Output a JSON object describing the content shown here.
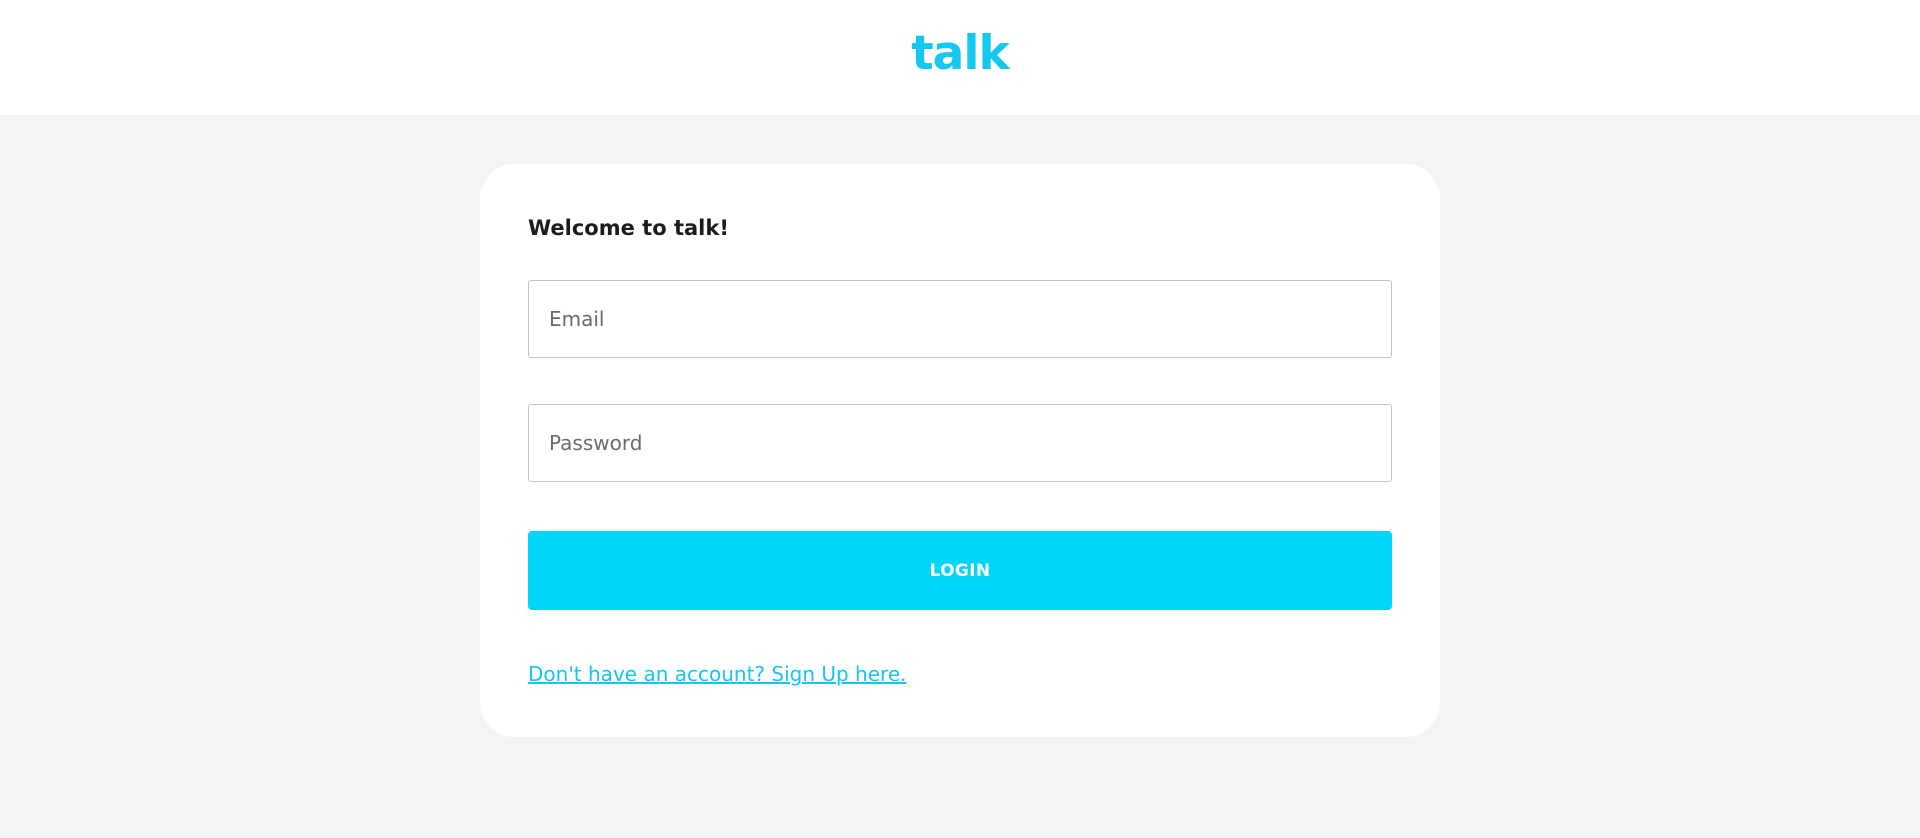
{
  "header": {
    "logo_text": "talk"
  },
  "login_form": {
    "welcome_text": "Welcome to talk!",
    "email_placeholder": "Email",
    "email_value": "",
    "password_placeholder": "Password",
    "password_value": "",
    "login_label": "LOGIN",
    "signup_link_text": "Don't have an account? Sign Up here."
  },
  "colors": {
    "brand": "#14c8f0",
    "button": "#00d6fa",
    "page_background": "#f4f4f4",
    "card_background": "#ffffff"
  }
}
